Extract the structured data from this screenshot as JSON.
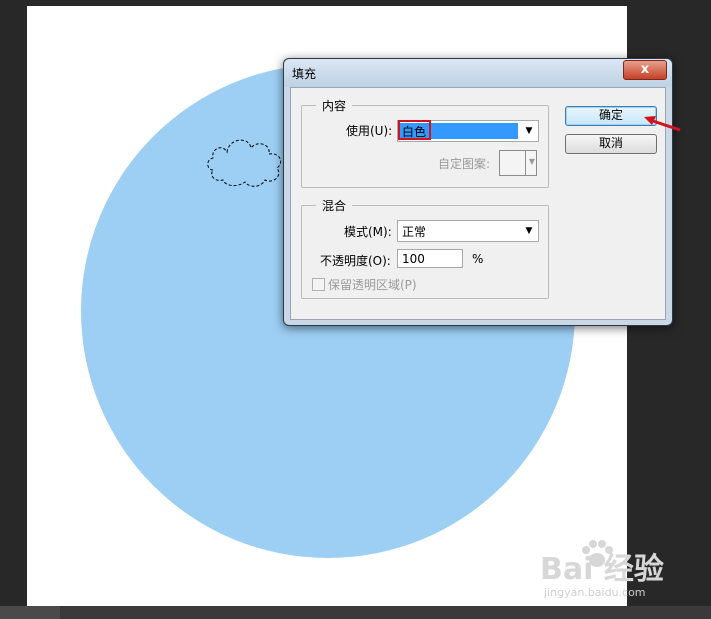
{
  "dialog": {
    "title": "填充",
    "close_label": "x",
    "content_group": {
      "legend": "内容",
      "use_label": "使用(U):",
      "use_value": "白色",
      "custom_pattern_label": "自定图案:"
    },
    "blend_group": {
      "legend": "混合",
      "mode_label": "模式(M):",
      "mode_value": "正常",
      "opacity_label": "不透明度(O):",
      "opacity_value": "100",
      "opacity_unit": "%",
      "preserve_transparency_label": "保留透明区域(P)"
    },
    "buttons": {
      "ok": "确定",
      "cancel": "取消"
    }
  },
  "canvas": {
    "circle_color": "#9dcff5"
  },
  "watermark": {
    "brand": "Bai 经验",
    "url": "jingyan.baidu.com"
  }
}
